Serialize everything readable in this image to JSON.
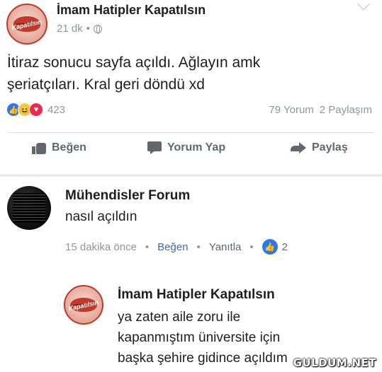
{
  "post": {
    "author": "İmam Hatipler Kapatılsın",
    "avatar_text": "Kapatılsın",
    "time": "21 dk",
    "meta_sep": "•",
    "text": "İtiraz sonucu sayfa açıldı. Ağlayın amk şeriatçıları. Kral geri döndü xd",
    "reaction_count": "423",
    "comments_count": "79 Yorum",
    "shares_count": "2 Paylaşım",
    "actions": {
      "like": "Beğen",
      "comment": "Yorum Yap",
      "share": "Paylaş"
    }
  },
  "comments": [
    {
      "author": "Mühendisler Forum",
      "text": "nasıl açıldın",
      "time": "15 dakika önce",
      "like_label": "Beğen",
      "reply_label": "Yanıtla",
      "like_count": "2",
      "dot": "•"
    }
  ],
  "reply": {
    "author": "İmam Hatipler Kapatılsın",
    "avatar_text": "Kapatılsın",
    "lines": [
      "ya zaten aile zoru ile",
      "kapanmıştım üniversite için",
      "başka şehire gidince açıldım"
    ]
  },
  "watermark": "GULDUM.NET",
  "colors": {
    "like_blue": "#2d78e6",
    "link_blue": "#4267b2",
    "muted": "#90949c",
    "haha": "#f7c844",
    "love": "#f0284a"
  },
  "icons": [
    "globe-icon",
    "chevron-down-icon",
    "like-reaction-icon",
    "haha-reaction-icon",
    "love-reaction-icon",
    "thumb-up-icon",
    "comment-icon",
    "share-arrow-icon"
  ]
}
